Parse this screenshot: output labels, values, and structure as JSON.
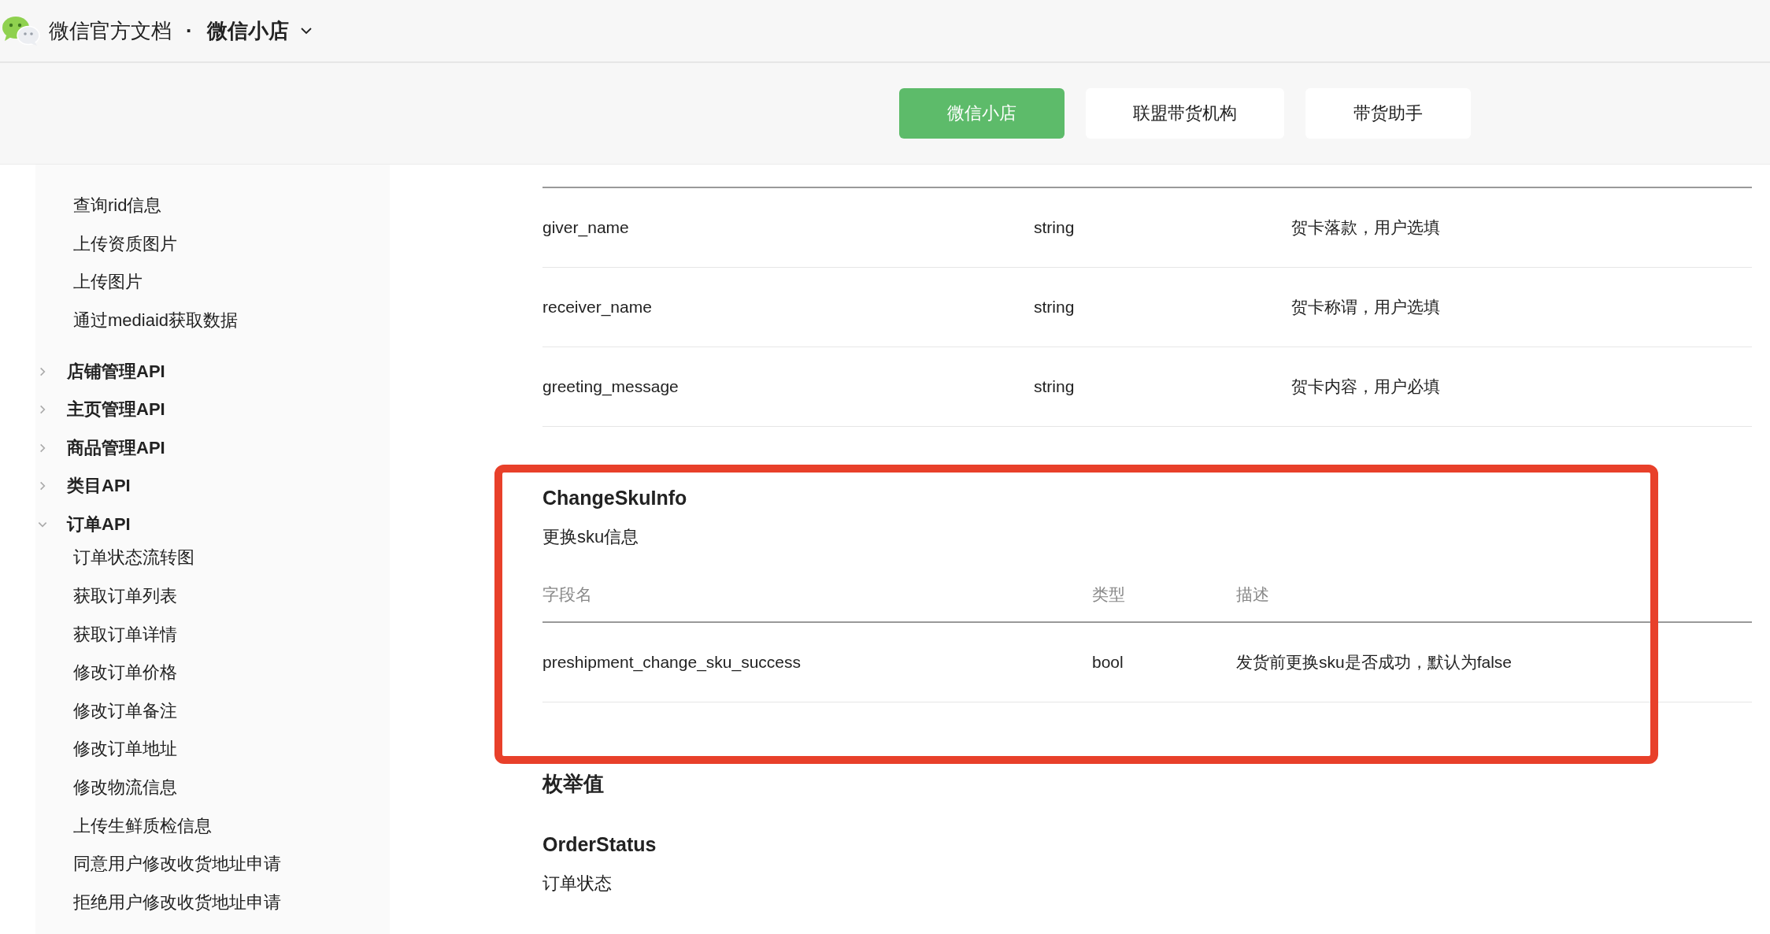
{
  "header": {
    "site_title": "微信官方文档",
    "separator": "·",
    "section": "微信小店"
  },
  "tabs": [
    {
      "label": "微信小店",
      "selected": true
    },
    {
      "label": "联盟带货机构",
      "selected": false
    },
    {
      "label": "带货助手",
      "selected": false
    }
  ],
  "sidebar": {
    "items": [
      "查询rid信息",
      "上传资质图片",
      "上传图片",
      "通过mediaid获取数据"
    ],
    "groups": [
      {
        "label": "店铺管理API",
        "expanded": false
      },
      {
        "label": "主页管理API",
        "expanded": false
      },
      {
        "label": "商品管理API",
        "expanded": false
      },
      {
        "label": "类目API",
        "expanded": false
      },
      {
        "label": "订单API",
        "expanded": true,
        "children": [
          "订单状态流转图",
          "获取订单列表",
          "获取订单详情",
          "修改订单价格",
          "修改订单备注",
          "修改订单地址",
          "修改物流信息",
          "上传生鲜质检信息",
          "同意用户修改收货地址申请",
          "拒绝用户修改收货地址申请"
        ]
      }
    ]
  },
  "content": {
    "greeting_table": {
      "rows": [
        [
          "giver_name",
          "string",
          "贺卡落款，用户选填"
        ],
        [
          "receiver_name",
          "string",
          "贺卡称谓，用户选填"
        ],
        [
          "greeting_message",
          "string",
          "贺卡内容，用户必填"
        ]
      ]
    },
    "change_sku_info": {
      "title": "ChangeSkuInfo",
      "description": "更换sku信息",
      "columns": [
        "字段名",
        "类型",
        "描述"
      ],
      "rows": [
        [
          "preshipment_change_sku_success",
          "bool",
          "发货前更换sku是否成功，默认为false"
        ]
      ]
    },
    "enum_heading": "枚举值",
    "order_status": {
      "title": "OrderStatus",
      "description": "订单状态"
    }
  }
}
